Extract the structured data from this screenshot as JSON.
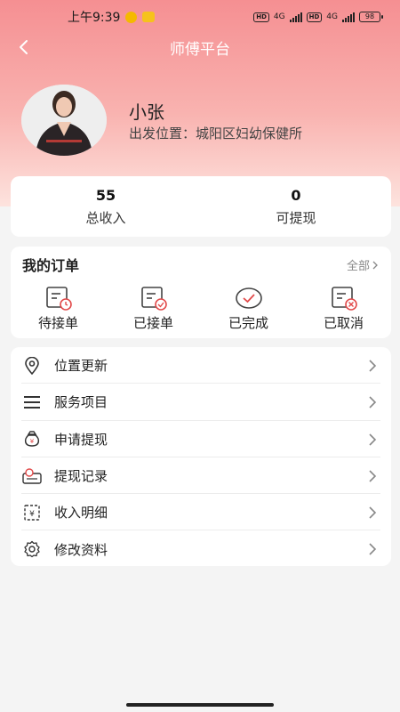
{
  "status_bar": {
    "time": "上午9:39",
    "battery": "98",
    "network": "4G"
  },
  "nav": {
    "title": "师傅平台"
  },
  "profile": {
    "name": "小张",
    "location_label": "出发位置：",
    "location_value": "城阳区妇幼保健所"
  },
  "stats": [
    {
      "value": "55",
      "label": "总收入"
    },
    {
      "value": "0",
      "label": "可提现"
    }
  ],
  "orders": {
    "title": "我的订单",
    "all_label": "全部",
    "items": [
      {
        "label": "待接单",
        "icon": "pending-order-icon"
      },
      {
        "label": "已接单",
        "icon": "accepted-order-icon"
      },
      {
        "label": "已完成",
        "icon": "completed-order-icon"
      },
      {
        "label": "已取消",
        "icon": "cancelled-order-icon"
      }
    ]
  },
  "menu": [
    {
      "label": "位置更新",
      "icon": "location-pin-icon"
    },
    {
      "label": "服务项目",
      "icon": "list-icon"
    },
    {
      "label": "申请提现",
      "icon": "money-bag-icon"
    },
    {
      "label": "提现记录",
      "icon": "withdraw-record-icon"
    },
    {
      "label": "收入明细",
      "icon": "income-detail-icon"
    },
    {
      "label": "修改资料",
      "icon": "gear-icon"
    }
  ],
  "colors": {
    "header_top": "#f58f92",
    "header_bottom": "#fde3de",
    "accent": "#e24a4a",
    "background": "#f4f4f4"
  }
}
